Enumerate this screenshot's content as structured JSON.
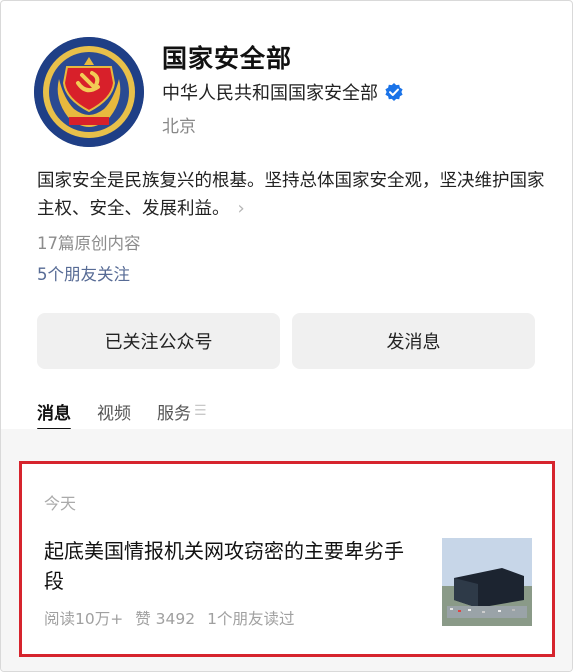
{
  "account": {
    "name": "国家安全部",
    "org": "中华人民共和国国家安全部",
    "location": "北京",
    "verified_icon": "verified-check-icon"
  },
  "profile": {
    "description": "国家安全是民族复兴的根基。坚持总体国家安全观，坚决维护国家主权、安全、发展利益。",
    "original_count": "17篇原创内容",
    "friends_following": "5个朋友关注"
  },
  "actions": {
    "follow_label": "已关注公众号",
    "message_label": "发消息"
  },
  "tabs": [
    {
      "label": "消息",
      "active": true
    },
    {
      "label": "视频",
      "active": false
    },
    {
      "label": "服务",
      "active": false
    }
  ],
  "feed": {
    "date": "今天",
    "article": {
      "title": "起底美国情报机关网攻窃密的主要卑劣手段",
      "reads": "阅读10万+",
      "likes": "赞 3492",
      "friends_read": "1个朋友读过"
    }
  },
  "colors": {
    "link": "#576b95",
    "highlight_border": "#d6242d",
    "verified": "#1a73e8"
  }
}
